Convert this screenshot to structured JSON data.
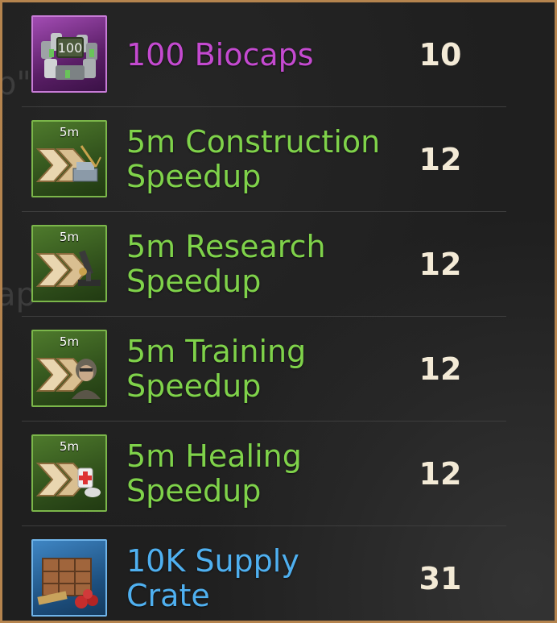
{
  "items": [
    {
      "name_line1": "100 Biocaps",
      "name_line2": "",
      "quantity": "10",
      "rarity": "purple",
      "color": "#c44ad0",
      "icon": "biocaps-icon",
      "badge": "100",
      "duration": ""
    },
    {
      "name_line1": "5m Construction",
      "name_line2": "Speedup",
      "quantity": "12",
      "rarity": "green",
      "color": "#7fd24a",
      "icon": "construction-speedup-icon",
      "badge": "",
      "duration": "5m"
    },
    {
      "name_line1": "5m Research",
      "name_line2": "Speedup",
      "quantity": "12",
      "rarity": "green",
      "color": "#7fd24a",
      "icon": "research-speedup-icon",
      "badge": "",
      "duration": "5m"
    },
    {
      "name_line1": "5m Training",
      "name_line2": "Speedup",
      "quantity": "12",
      "rarity": "green",
      "color": "#7fd24a",
      "icon": "training-speedup-icon",
      "badge": "",
      "duration": "5m"
    },
    {
      "name_line1": "5m Healing",
      "name_line2": "Speedup",
      "quantity": "12",
      "rarity": "green",
      "color": "#7fd24a",
      "icon": "healing-speedup-icon",
      "badge": "",
      "duration": "5m"
    },
    {
      "name_line1": "10K Supply",
      "name_line2": "Crate",
      "quantity": "31",
      "rarity": "blue",
      "color": "#4fb0f0",
      "icon": "supply-crate-icon",
      "badge": "",
      "duration": ""
    }
  ],
  "colors": {
    "border": "#b5844e",
    "quantity": "#f3ead6"
  }
}
